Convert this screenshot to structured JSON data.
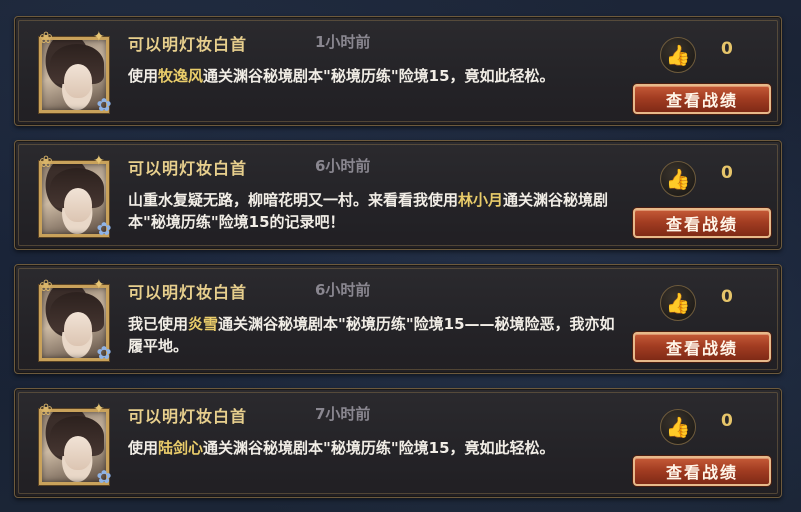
{
  "colors": {
    "name": "#e7cf8d",
    "time": "#8a8790",
    "highlight": "#e9cc6a",
    "button": "#a33d22",
    "like_count": "#e6c56a"
  },
  "icons": {
    "like": "thumbs-up-icon"
  },
  "records": [
    {
      "name": "可以明灯妆白首",
      "time": "1小时前",
      "msg_before": "使用",
      "msg_highlight": "牧逸风",
      "msg_after": "通关渊谷秘境剧本\"秘境历练\"险境15，竟如此轻松。",
      "likes": "0",
      "button": "查看战绩"
    },
    {
      "name": "可以明灯妆白首",
      "time": "6小时前",
      "msg_before": "山重水复疑无路，柳暗花明又一村。来看看我使用",
      "msg_highlight": "林小月",
      "msg_after": "通关渊谷秘境剧本\"秘境历练\"险境15的记录吧！",
      "likes": "0",
      "button": "查看战绩"
    },
    {
      "name": "可以明灯妆白首",
      "time": "6小时前",
      "msg_before": "我已使用",
      "msg_highlight": "炎雪",
      "msg_after": "通关渊谷秘境剧本\"秘境历练\"险境15——秘境险恶，我亦如履平地。",
      "likes": "0",
      "button": "查看战绩"
    },
    {
      "name": "可以明灯妆白首",
      "time": "7小时前",
      "msg_before": "使用",
      "msg_highlight": "陆剑心",
      "msg_after": "通关渊谷秘境剧本\"秘境历练\"险境15，竟如此轻松。",
      "likes": "0",
      "button": "查看战绩"
    }
  ]
}
